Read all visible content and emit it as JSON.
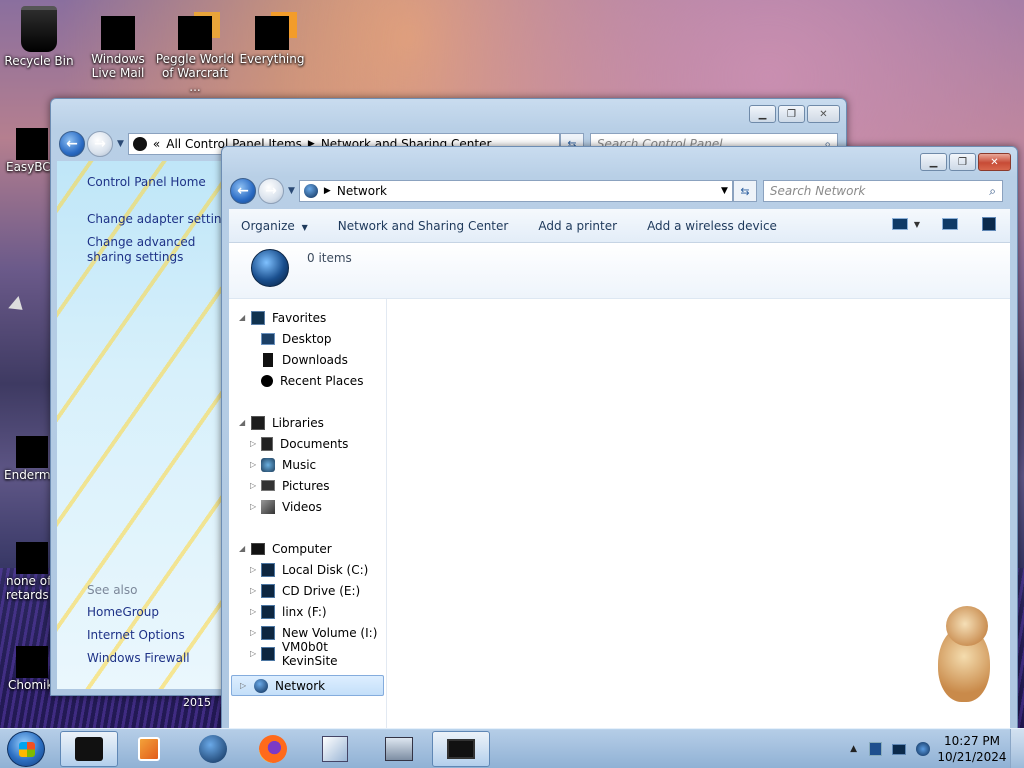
{
  "desktop": {
    "icons": [
      {
        "label": "Recycle Bin"
      },
      {
        "label": "Windows Live Mail"
      },
      {
        "label": "Peggle World of Warcraft ..."
      },
      {
        "label": "Everything"
      }
    ],
    "left_icons": [
      {
        "label": "EasyBCD"
      },
      {
        "label": "Enderma"
      },
      {
        "label": "none of retards k"
      },
      {
        "label": "Chomik"
      }
    ],
    "year_text": "2015"
  },
  "control_panel": {
    "breadcrumb": [
      "All Control Panel Items",
      "Network and Sharing Center"
    ],
    "breadcrumb_prefix": "«",
    "search_placeholder": "Search Control Panel",
    "links": [
      "Control Panel Home",
      "Change adapter settings",
      "Change advanced sharing settings"
    ],
    "see_also_label": "See also",
    "see_also": [
      "HomeGroup",
      "Internet Options",
      "Windows Firewall"
    ]
  },
  "explorer": {
    "address": "Network",
    "search_placeholder": "Search Network",
    "commands": [
      "Organize",
      "Network and Sharing Center",
      "Add a printer",
      "Add a wireless device"
    ],
    "item_count": "0 items",
    "nav": {
      "favorites": {
        "label": "Favorites",
        "items": [
          "Desktop",
          "Downloads",
          "Recent Places"
        ]
      },
      "libraries": {
        "label": "Libraries",
        "items": [
          "Documents",
          "Music",
          "Pictures",
          "Videos"
        ]
      },
      "computer": {
        "label": "Computer",
        "items": [
          "Local Disk (C:)",
          "CD Drive (E:)",
          "linx (F:)",
          "New Volume (I:)",
          "VM0b0t KevinSite"
        ]
      },
      "network": {
        "label": "Network"
      }
    }
  },
  "taskbar": {
    "clock_time": "10:27 PM",
    "clock_date": "10/21/2024",
    "tray_chevron": "▲"
  },
  "colors": {
    "link": "#1e3287",
    "close_button": "#c74b36"
  }
}
